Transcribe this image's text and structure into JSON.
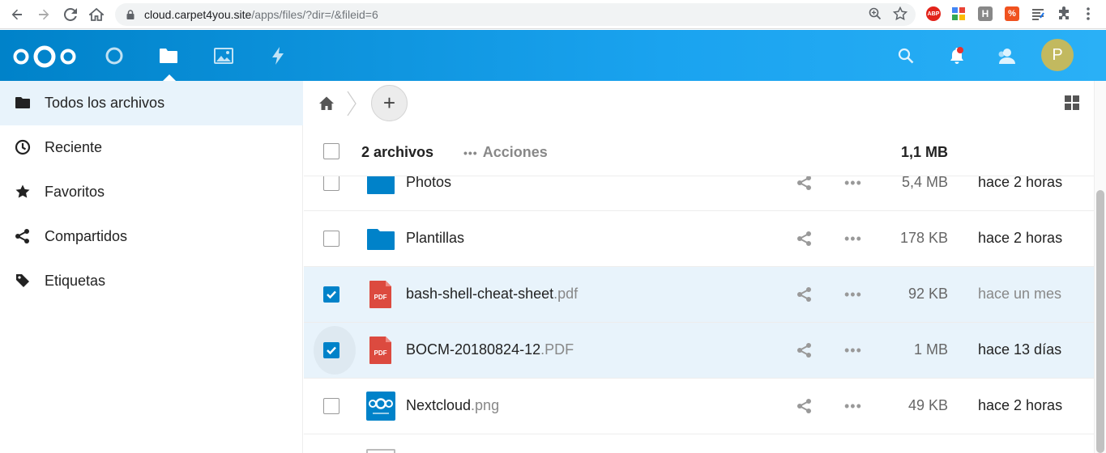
{
  "browser": {
    "url_host": "cloud.carpet4you.site",
    "url_path": "/apps/files/?dir=/&fileid=6",
    "ext_abp": "ABP",
    "ext_h": "H",
    "ext_orange": "%"
  },
  "header": {
    "avatar_letter": "P",
    "colors": {
      "primary": "#0082c9",
      "gradient_end": "#2ab0f6",
      "avatar": "#c2b95f"
    }
  },
  "sidebar": {
    "items": [
      {
        "label": "Todos los archivos",
        "icon": "folder-icon",
        "active": true
      },
      {
        "label": "Reciente",
        "icon": "clock-icon"
      },
      {
        "label": "Favoritos",
        "icon": "star-icon"
      },
      {
        "label": "Compartidos",
        "icon": "share-icon"
      },
      {
        "label": "Etiquetas",
        "icon": "tag-icon"
      }
    ]
  },
  "main": {
    "add_label": "+",
    "list_header": {
      "count": "2 archivos",
      "actions_label": "Acciones",
      "total_size": "1,1 MB"
    },
    "files": [
      {
        "name": "Photos",
        "ext": "",
        "type": "folder",
        "size": "5,4 MB",
        "modified": "hace 2 horas",
        "selected": false
      },
      {
        "name": "Plantillas",
        "ext": "",
        "type": "folder",
        "size": "178 KB",
        "modified": "hace 2 horas",
        "selected": false
      },
      {
        "name": "bash-shell-cheat-sheet",
        "ext": ".pdf",
        "type": "pdf",
        "icon_label": "PDF",
        "size": "92 KB",
        "modified": "hace un mes",
        "selected": true
      },
      {
        "name": "BOCM-20180824-12",
        "ext": ".PDF",
        "type": "pdf",
        "icon_label": "PDF",
        "size": "1 MB",
        "modified": "hace 13 días",
        "selected": true
      },
      {
        "name": "Nextcloud",
        "ext": ".png",
        "type": "image",
        "size": "49 KB",
        "modified": "hace 2 horas",
        "selected": false
      }
    ]
  }
}
